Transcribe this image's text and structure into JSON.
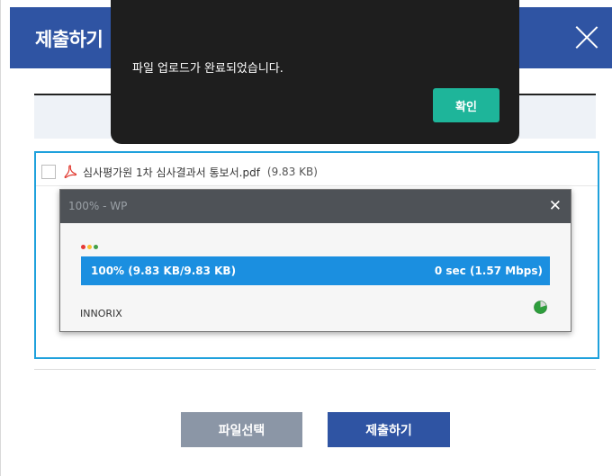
{
  "modal": {
    "title": "제출하기"
  },
  "file": {
    "name": "심사평가원 1차 심사결과서 통보서.pdf",
    "size": "(9.83 KB)"
  },
  "uploader": {
    "title": "100% - WP",
    "close_symbol": "✕",
    "progress_percent": 100,
    "progress_left": "100% (9.83 KB/9.83 KB)",
    "progress_right": "0 sec (1.57 Mbps)",
    "brand": "INNORIX",
    "dot_colors": [
      "#e53935",
      "#fbc02d",
      "#43a047"
    ],
    "progress_color": "#1b8fe0",
    "status_icon": "pie-complete-icon"
  },
  "buttons": {
    "select_file": "파일선택",
    "submit": "제출하기"
  },
  "alert": {
    "message": "파일 업로드가 완료되었습니다.",
    "confirm": "확인"
  },
  "colors": {
    "header": "#2f54a3",
    "accent": "#1fa1dc",
    "confirm": "#1eb59a"
  }
}
